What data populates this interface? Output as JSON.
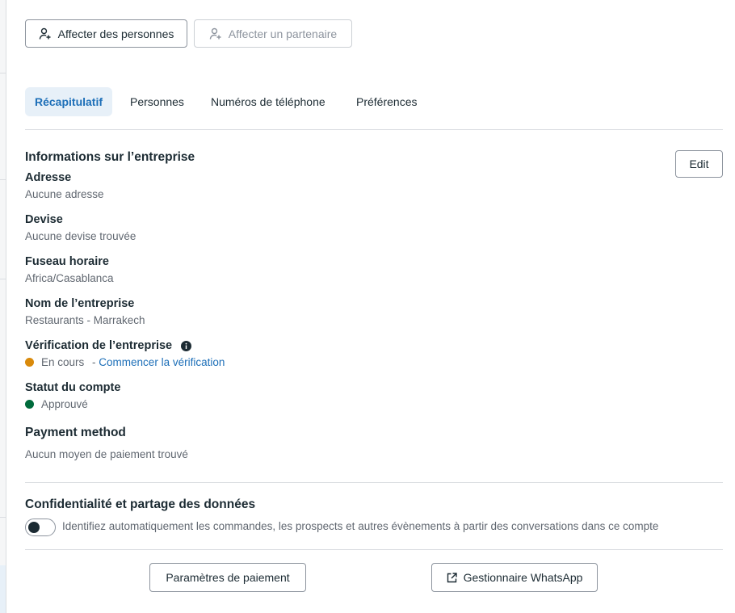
{
  "actions": {
    "assign_people": "Affecter des personnes",
    "assign_partner": "Affecter un partenaire"
  },
  "tabs": [
    {
      "label": "Récapitulatif",
      "active": true
    },
    {
      "label": "Personnes",
      "active": false
    },
    {
      "label": "Numéros de téléphone",
      "active": false
    },
    {
      "label": "Préférences",
      "active": false
    }
  ],
  "business_info": {
    "title": "Informations sur l’entreprise",
    "edit_label": "Edit",
    "address": {
      "label": "Adresse",
      "value": "Aucune adresse"
    },
    "currency": {
      "label": "Devise",
      "value": "Aucune devise trouvée"
    },
    "timezone": {
      "label": "Fuseau horaire",
      "value": "Africa/Casablanca"
    },
    "business_name": {
      "label": "Nom de l’entreprise",
      "value": "Restaurants - Marrakech"
    },
    "verification": {
      "label": "Vérification de l’entreprise",
      "status": "En cours",
      "separator": "- ",
      "link": "Commencer la vérification",
      "status_color": "#d98a0b"
    },
    "account_status": {
      "label": "Statut du compte",
      "status": "Approuvé",
      "status_color": "#006b3c"
    },
    "payment": {
      "label": "Payment method",
      "value": "Aucun moyen de paiement trouvé"
    }
  },
  "privacy": {
    "title": "Confidentialité et partage des données",
    "toggle_label": "Identifiez automatiquement les commandes, les prospects et autres évènements à partir des conversations dans ce compte",
    "toggle_on": false
  },
  "footer": {
    "payment_settings": "Paramètres de paiement",
    "whatsapp_manager": "Gestionnaire WhatsApp"
  },
  "colors": {
    "accent": "#1d6fb8",
    "active_tab_bg": "#e7f0f8",
    "text_primary": "#1c2b33",
    "text_secondary": "#606770"
  }
}
